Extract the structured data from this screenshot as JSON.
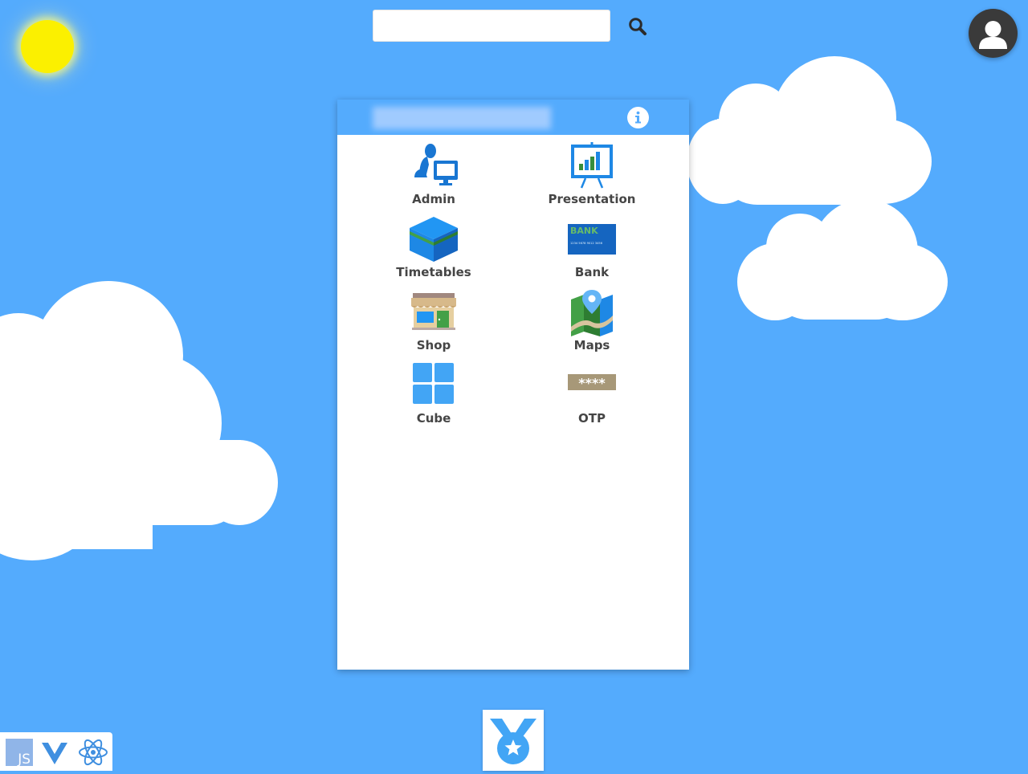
{
  "search": {
    "value": "",
    "placeholder": ""
  },
  "launcher": {
    "apps": [
      {
        "label": "Admin",
        "icon": "admin-icon"
      },
      {
        "label": "Presentation",
        "icon": "presentation-icon"
      },
      {
        "label": "Timetables",
        "icon": "timetables-icon"
      },
      {
        "label": "Bank",
        "icon": "bank-card-icon"
      },
      {
        "label": "Shop",
        "icon": "shop-icon"
      },
      {
        "label": "Maps",
        "icon": "map-icon"
      },
      {
        "label": "Cube",
        "icon": "cube-grid-icon"
      },
      {
        "label": "OTP",
        "icon": "otp-icon"
      }
    ],
    "bank_card_text": "BANK",
    "bank_card_number": "1234 5678 9012 3456",
    "otp_mask": "****"
  },
  "tech": {
    "js_label": "JS"
  },
  "icons": {
    "search": "search-icon",
    "avatar": "user-avatar-icon",
    "info": "info-icon",
    "badge": "medal-icon",
    "js": "javascript-icon",
    "vue": "vue-icon",
    "react": "react-icon"
  },
  "colors": {
    "sky": "#54abfd",
    "sun": "#fbf000",
    "panel": "#ffffff",
    "label": "#454545"
  }
}
